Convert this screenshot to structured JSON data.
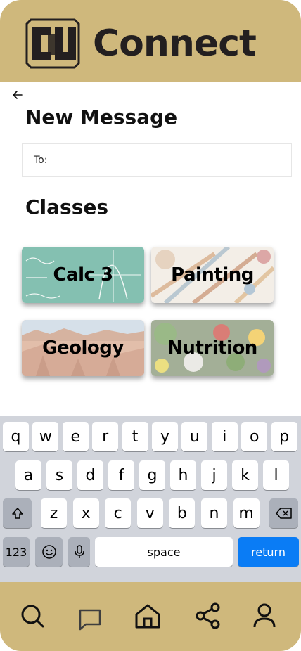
{
  "header": {
    "app_title": "Connect",
    "logo": "cu-logo"
  },
  "page": {
    "back_icon": "arrow-left-icon",
    "title": "New Message",
    "to_label": "To:",
    "classes_title": "Classes"
  },
  "classes": [
    {
      "label": "Calc 3",
      "image": "chalkboard-math"
    },
    {
      "label": "Painting",
      "image": "paint-brushes"
    },
    {
      "label": "Geology",
      "image": "canyon-rocks"
    },
    {
      "label": "Nutrition",
      "image": "vegetables"
    }
  ],
  "keyboard": {
    "row1": [
      "q",
      "w",
      "e",
      "r",
      "t",
      "y",
      "u",
      "i",
      "o",
      "p"
    ],
    "row2": [
      "a",
      "s",
      "d",
      "f",
      "g",
      "h",
      "j",
      "k",
      "l"
    ],
    "row3": [
      "z",
      "x",
      "c",
      "v",
      "b",
      "n",
      "m"
    ],
    "numbers_label": "123",
    "space_label": "space",
    "return_label": "return"
  },
  "nav": [
    "search-icon",
    "chat-icon",
    "home-icon",
    "share-icon",
    "profile-icon"
  ],
  "colors": {
    "gold": "#CFB87C",
    "return_blue": "#0A7CF5",
    "keyboard_bg": "#D1D4DB"
  }
}
